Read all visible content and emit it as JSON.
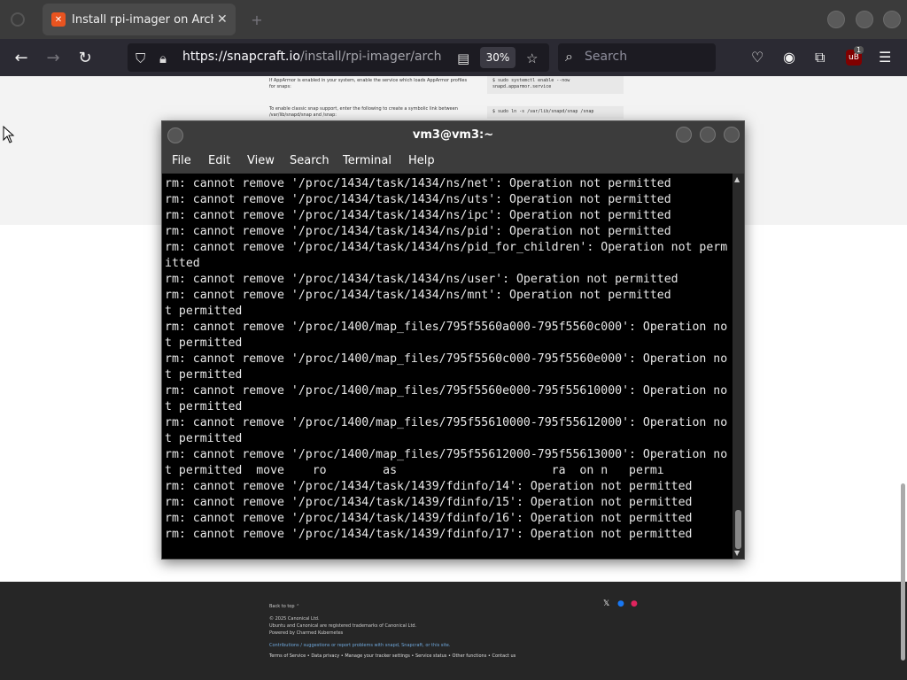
{
  "browser": {
    "tab_title": "Install rpi-imager on Arch L",
    "tab_favicon": "snapcraft-icon",
    "url_host": "https://snapcraft.io",
    "url_path": "/install/rpi-imager/arch",
    "zoom": "30%",
    "search_placeholder": "Search",
    "extension_badge": "1"
  },
  "page": {
    "doc_left_1": "If AppArmor is enabled in your system, enable the service which loads AppArmor profiles for snaps:",
    "doc_left_2": "To enable classic snap support, enter the following to create a symbolic link between /var/lib/snapd/snap and /snap:",
    "doc_right_1": "$ sudo systemctl enable --now snapd.apparmor.service",
    "doc_right_2": "$ sudo ln -s /var/lib/snapd/snap /snap",
    "footer_back_to_top": "Back to top ⌃",
    "footer_copyright": "© 2025 Canonical Ltd.",
    "footer_trademark": "Ubuntu and Canonical are registered trademarks of Canonical Ltd.",
    "footer_powered": "Powered by Charmed Kubernetes",
    "footer_contrib": "Contributions / suggestions or report problems with snapd, Snapcraft, or this site.",
    "footer_links": "Terms of Service  •  Data privacy  •  Manage your tracker settings  •  Service status  •  Other functions  •  Contact us"
  },
  "terminal": {
    "title": "vm3@vm3:~",
    "menu": [
      "File",
      "Edit",
      "View",
      "Search",
      "Terminal",
      "Help"
    ],
    "lines": [
      "rm: cannot remove '/proc/1434/task/1434/ns/net': Operation not permitted",
      "rm: cannot remove '/proc/1434/task/1434/ns/uts': Operation not permitted",
      "rm: cannot remove '/proc/1434/task/1434/ns/ipc': Operation not permitted",
      "rm: cannot remove '/proc/1434/task/1434/ns/pid': Operation not permitted",
      "rm: cannot remove '/proc/1434/task/1434/ns/pid_for_children': Operation not perm",
      "itted",
      "rm: cannot remove '/proc/1434/task/1434/ns/user': Operation not permitted",
      "rm: cannot remove '/proc/1434/task/1434/ns/mnt': Operation not permitted",
      "t permitted",
      "rm: cannot remove '/proc/1400/map_files/795f5560a000-795f5560c000': Operation no",
      "t permitted",
      "rm: cannot remove '/proc/1400/map_files/795f5560c000-795f5560e000': Operation no",
      "t permitted",
      "rm: cannot remove '/proc/1400/map_files/795f5560e000-795f55610000': Operation no",
      "t permitted",
      "rm: cannot remove '/proc/1400/map_files/795f55610000-795f55612000': Operation no",
      "t permitted",
      "rm: cannot remove '/proc/1400/map_files/795f55612000-795f55613000': Operation no",
      "t permitted  move    ro        as                      ra  on n   permı",
      "rm: cannot remove '/proc/1434/task/1439/fdinfo/14': Operation not permitted",
      "rm: cannot remove '/proc/1434/task/1439/fdinfo/15': Operation not permitted",
      "rm: cannot remove '/proc/1434/task/1439/fdinfo/16': Operation not permitted",
      "rm: cannot remove '/proc/1434/task/1439/fdinfo/17': Operation not permitted",
      ""
    ]
  }
}
